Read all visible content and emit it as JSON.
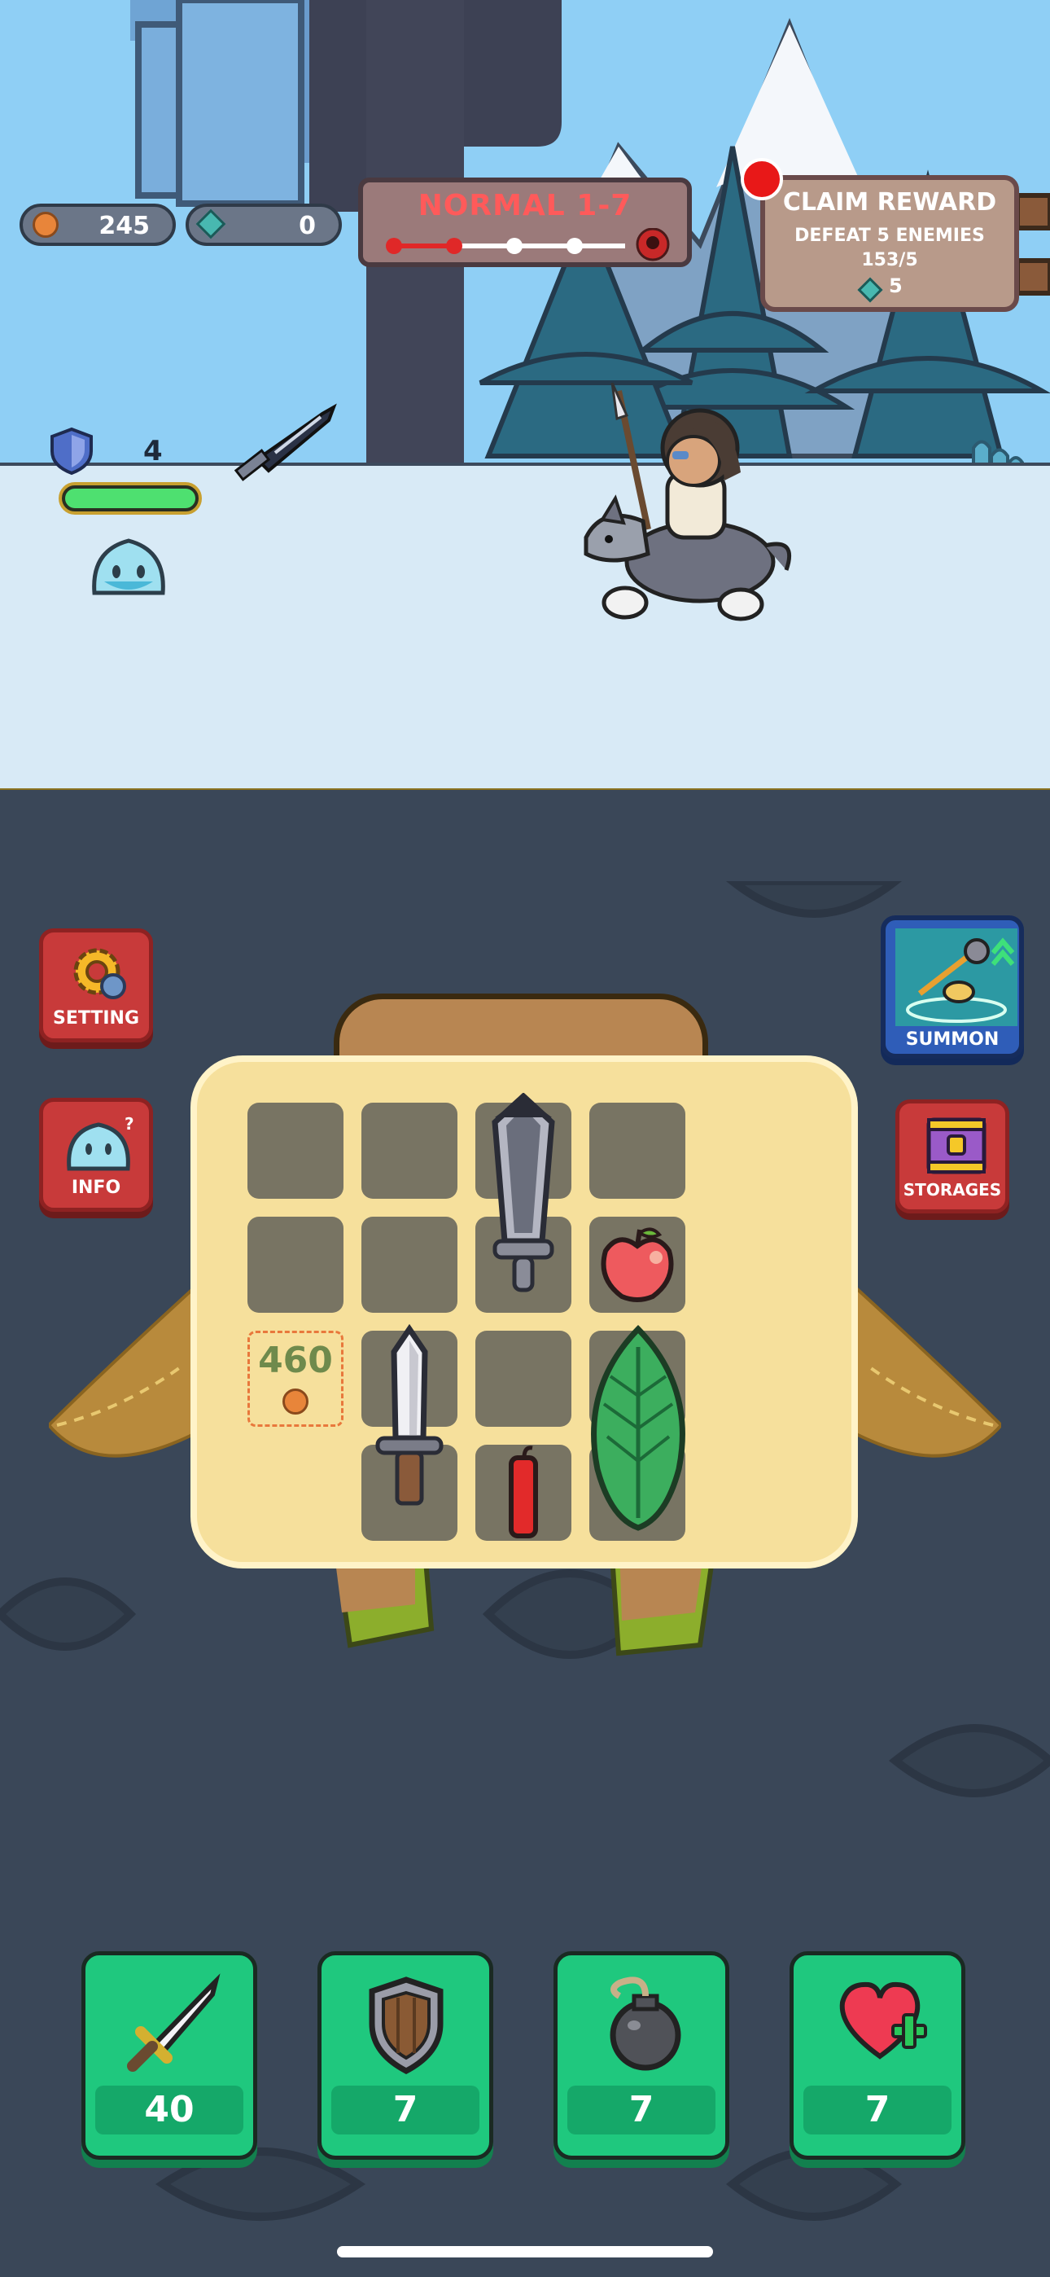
{
  "currency": {
    "coins": "245",
    "gems": "0"
  },
  "stage": {
    "title": "NORMAL 1-7",
    "progress_steps_done": 2,
    "progress_steps_total": 5
  },
  "quest": {
    "title": "CLAIM REWARD",
    "objective": "DEFEAT 5 ENEMIES",
    "progress": "153/5",
    "reward": "5",
    "has_notification": true
  },
  "player": {
    "shield_level": "4",
    "health_fraction": 1.0
  },
  "side_buttons": {
    "setting": "SETTING",
    "info": "INFO",
    "summon": "SUMMON",
    "storages": "STORAGES"
  },
  "bag": {
    "slot_price": "460",
    "items": [
      "great-sword",
      "apple",
      "short-sword",
      "dynamite",
      "leaf"
    ]
  },
  "stats": {
    "attack": "40",
    "defense": "7",
    "bomb": "7",
    "heal": "7"
  },
  "colors": {
    "sky": "#8fcff5",
    "snow": "#d8eaf6",
    "panel_bg": "#3a4758",
    "button_red": "#c83a3a",
    "summon_blue": "#2f5db8",
    "stat_green": "#1fc87e",
    "bag_cream": "#f6e09c",
    "danger_red": "#ff5a5a"
  }
}
